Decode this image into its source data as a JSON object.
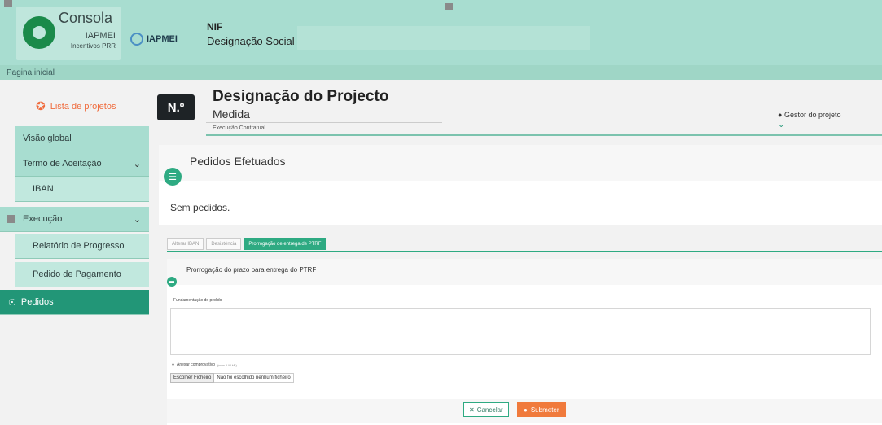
{
  "header": {
    "logo": {
      "title": "Consola",
      "sub1": "IAPMEI",
      "sub2": "Incentivos PRR"
    },
    "brand": "IAPMEI",
    "nif_label": "NIF",
    "company_name": "Designação Social"
  },
  "breadcrumb": {
    "home": "Pagina inicial"
  },
  "sidebar": {
    "lista_link": "Lista de projetos",
    "items": [
      {
        "label": "Visão global"
      },
      {
        "label": "Termo de Aceitação"
      },
      {
        "label": "IBAN"
      },
      {
        "label": "Execução"
      },
      {
        "label": "Relatório de Progresso"
      },
      {
        "label": "Pedido de Pagamento"
      },
      {
        "label": "Pedidos"
      }
    ]
  },
  "project": {
    "badge": "N.º",
    "title": "Designação do Projecto",
    "measure": "Medida",
    "phase": "Execução Contratual",
    "manager": "Gestor do projeto"
  },
  "requests": {
    "title": "Pedidos Efetuados",
    "empty": "Sem pedidos."
  },
  "tabs": [
    {
      "label": "Alterar IBAN",
      "active": false
    },
    {
      "label": "Desistência",
      "active": false
    },
    {
      "label": "Prorrogação de entrega de PTRF",
      "active": true
    }
  ],
  "form": {
    "title": "Prorrogação do prazo para entrega do PTRF",
    "field_label": "Fundamentação do pedido",
    "attach_label": "Anexar comprovativo",
    "attach_hint": "(max 1 M kB)",
    "file_button": "Escolher Ficheiro",
    "file_none": "Não foi escolhido nenhum ficheiro",
    "cancel": "Cancelar",
    "submit": "Submeter"
  },
  "colors": {
    "header": "#a8ddd0",
    "accent": "#229677",
    "orange": "#f07a3c"
  }
}
